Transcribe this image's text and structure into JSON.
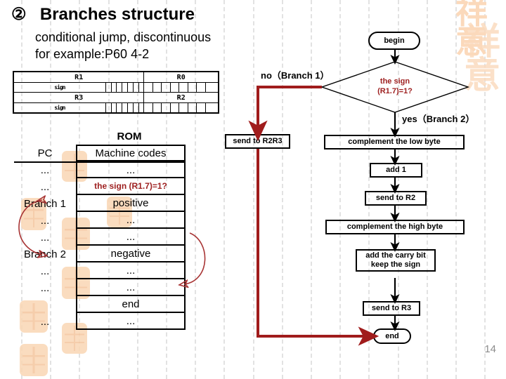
{
  "slide": {
    "number_marker": "②",
    "title": "Branches structure",
    "subtitle_line1": "conditional jump, discontinuous",
    "subtitle_line2": "for example:P60 4-2",
    "page_number": "14",
    "watermark_seal": "祥意"
  },
  "colors": {
    "red": "#9e2020",
    "dark_red_arrow": "#a01c1c",
    "black": "#000000",
    "gridline": "#e2e2e2",
    "watermark_peach": "#fad7b4",
    "page_number_gray": "#8c8c8c"
  },
  "registers": {
    "high_label_left": "R1",
    "high_label_right": "R0",
    "low_label_left": "R3",
    "low_label_right": "R2",
    "sign_label": "sign",
    "cells_per_half": 8
  },
  "rom": {
    "title": "ROM",
    "col_pc": "PC",
    "col_codes": "Machine codes",
    "rows": [
      {
        "pc": "...",
        "code": "...",
        "red": false
      },
      {
        "pc": "...",
        "code": "the sign (R1.7)=1?",
        "red": true
      },
      {
        "pc": "Branch 1",
        "code": "positive",
        "red": false
      },
      {
        "pc": "...",
        "code": "...",
        "red": false
      },
      {
        "pc": "...",
        "code": "...",
        "red": false
      },
      {
        "pc": "Branch 2",
        "code": "negative",
        "red": false
      },
      {
        "pc": "...",
        "code": "...",
        "red": false
      },
      {
        "pc": "...",
        "code": "...",
        "red": false
      },
      {
        "pc": "",
        "code": "end",
        "red": false
      },
      {
        "pc": "...",
        "code": "...",
        "red": false
      }
    ]
  },
  "flowchart": {
    "begin": "begin",
    "decision_line1": "the sign",
    "decision_line2": "(R1.7)=1?",
    "branch_no_label": "no（Branch 1）",
    "branch_yes_label": "yes（Branch 2）",
    "box_send_r2r3": "send to R2R3",
    "box_complement_low": "complement the low byte",
    "box_add_one": "add 1",
    "box_send_r2": "send to R2",
    "box_complement_high": "complement the high byte",
    "box_carry_line1": "add the carry bit",
    "box_carry_line2": "keep the sign",
    "box_send_r3": "send to R3",
    "end": "end"
  }
}
